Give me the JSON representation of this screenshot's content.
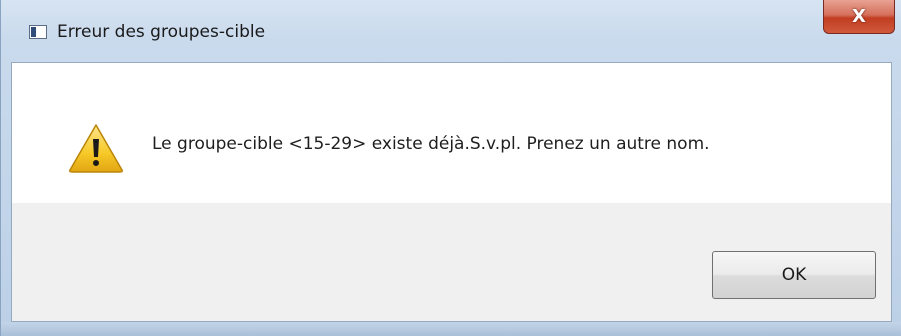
{
  "window": {
    "title": "Erreur des groupes-cible",
    "close_label": "X"
  },
  "dialog": {
    "icon": "warning-icon",
    "message": "Le groupe-cible <15-29> existe déjà.S.v.pl. Prenez un autre nom.",
    "ok_label": "OK"
  },
  "colors": {
    "close_button": "#c94a30",
    "content_background": "#ffffff",
    "footer_background": "#f0f0f0",
    "warning_yellow": "#f6c928"
  }
}
